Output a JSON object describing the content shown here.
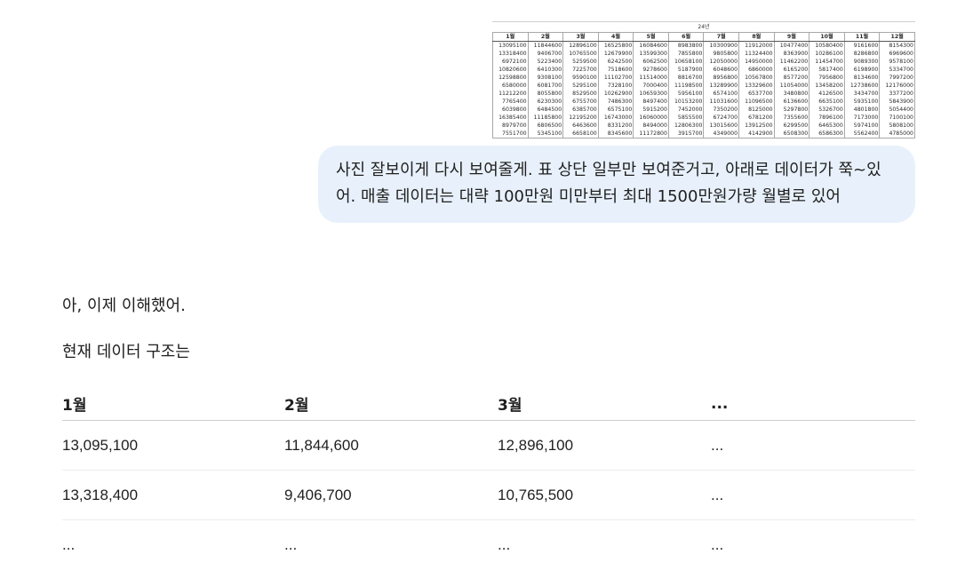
{
  "attachment": {
    "year_label": "24년",
    "headers": [
      "1월",
      "2월",
      "3월",
      "4월",
      "5월",
      "6월",
      "7월",
      "8월",
      "9월",
      "10월",
      "11월",
      "12월"
    ],
    "rows": [
      [
        "13095100",
        "11844600",
        "12896100",
        "16525800",
        "16084600",
        "8983800",
        "10300900",
        "11912000",
        "10477400",
        "10580400",
        "9161600",
        "8154300"
      ],
      [
        "13318400",
        "9406700",
        "10765500",
        "12679900",
        "13599300",
        "7855800",
        "9805800",
        "11324400",
        "8363900",
        "10286100",
        "8286800",
        "6969600"
      ],
      [
        "6972100",
        "5223400",
        "5259500",
        "6242500",
        "6062500",
        "10658100",
        "12050000",
        "14950000",
        "11462200",
        "11454700",
        "9089300",
        "9578100"
      ],
      [
        "10820600",
        "6410300",
        "7225700",
        "7518600",
        "9278600",
        "5187900",
        "6048600",
        "6860000",
        "6165200",
        "5817400",
        "6198900",
        "5334700"
      ],
      [
        "12598800",
        "9308100",
        "9590100",
        "11102700",
        "11514000",
        "8816700",
        "8956800",
        "10567800",
        "8577200",
        "7956800",
        "8134600",
        "7997200"
      ],
      [
        "6580000",
        "6081700",
        "5295100",
        "7328100",
        "7000400",
        "11198500",
        "13289900",
        "13329600",
        "11054000",
        "13458200",
        "12738600",
        "12176000"
      ],
      [
        "11212200",
        "8055800",
        "8529500",
        "10262900",
        "10659300",
        "5956100",
        "6574100",
        "6537700",
        "3480800",
        "4126500",
        "3434700",
        "3377200"
      ],
      [
        "7765400",
        "6230300",
        "6755700",
        "7486300",
        "8497400",
        "10153200",
        "11031600",
        "11096500",
        "6136600",
        "6635100",
        "5935100",
        "5843900"
      ],
      [
        "6039800",
        "6484500",
        "6385700",
        "6575100",
        "5915200",
        "7452000",
        "7350200",
        "8125000",
        "5297800",
        "5326700",
        "4801800",
        "5054400"
      ],
      [
        "16385400",
        "11185800",
        "12195200",
        "16743000",
        "16060000",
        "5855500",
        "6724700",
        "6781200",
        "7355600",
        "7896100",
        "7173000",
        "7100100"
      ],
      [
        "8979700",
        "6806500",
        "6463600",
        "8331200",
        "8494000",
        "12806300",
        "13015600",
        "13912500",
        "6299500",
        "6465300",
        "5974100",
        "5808100"
      ],
      [
        "7551700",
        "5345100",
        "6658100",
        "8345600",
        "11172800",
        "3915700",
        "4349000",
        "4142900",
        "6508300",
        "6586300",
        "5562400",
        "4785000"
      ]
    ]
  },
  "user_message": {
    "text": "사진 잘보이게 다시 보여줄게. 표 상단 일부만 보여준거고, 아래로 데이터가 쭉~있어. 매출 데이터는 대략 100만원 미만부터 최대 1500만원가량 월별로 있어"
  },
  "assistant": {
    "para1": "아, 이제 이해했어.",
    "para2": "현재 데이터 구조는",
    "table": {
      "headers": [
        "1월",
        "2월",
        "3월",
        "..."
      ],
      "rows": [
        [
          "13,095,100",
          "11,844,600",
          "12,896,100",
          "..."
        ],
        [
          "13,318,400",
          "9,406,700",
          "10,765,500",
          "..."
        ],
        [
          "...",
          "...",
          "...",
          "..."
        ]
      ]
    }
  }
}
